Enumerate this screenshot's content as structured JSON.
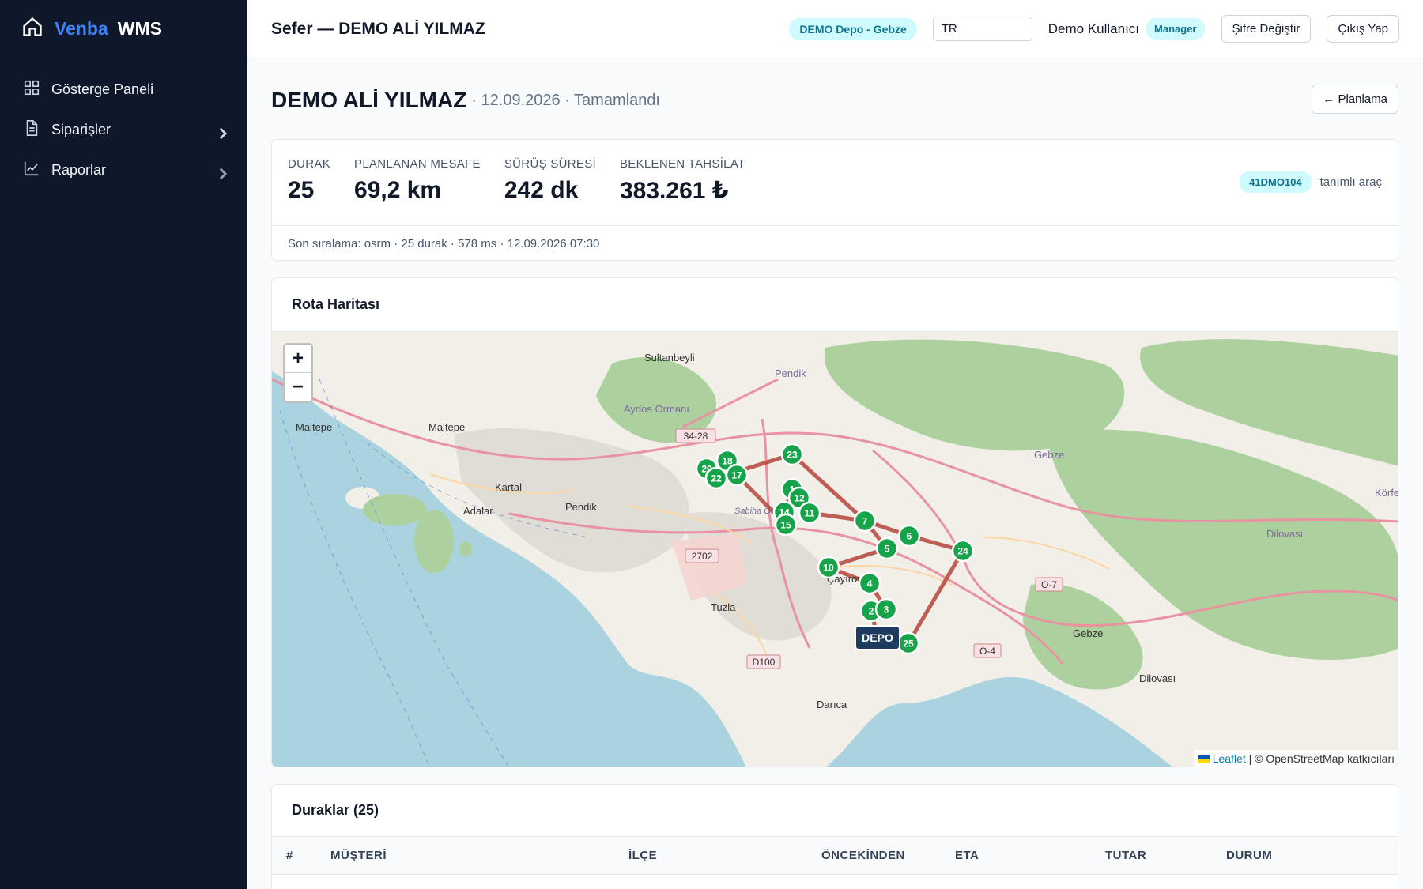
{
  "sidebar": {
    "brand_part1": "Venba",
    "brand_part2": "WMS",
    "items": [
      {
        "label": "Gösterge Paneli",
        "icon": "grid-icon"
      },
      {
        "label": "Siparişler",
        "icon": "document-icon"
      },
      {
        "label": "Raporlar",
        "icon": "chart-line-icon"
      }
    ]
  },
  "header": {
    "title": "Sefer — DEMO ALİ YILMAZ",
    "depot": "DEMO Depo - Gebze",
    "language_value": "TR",
    "user_name": "Demo Kullanıcı",
    "role": "Manager",
    "change_password": "Şifre Değiştir",
    "logout": "Çıkış Yap"
  },
  "page": {
    "driver": "DEMO ALİ YILMAZ",
    "meta": "· 12.09.2026 · Tamamlandı",
    "back_label": "← Planlama"
  },
  "stats": {
    "items": [
      {
        "label": "DURAK",
        "value": "25"
      },
      {
        "label": "PLANLANAN MESAFE",
        "value": "69,2 km"
      },
      {
        "label": "SÜRÜŞ SÜRESİ",
        "value": "242 dk"
      },
      {
        "label": "BEKLENEN TAHSİLAT",
        "value": "383.261 ₺"
      }
    ],
    "plate": "41DMO104",
    "plate_note": "tanımlı araç",
    "last_sort": "Son sıralama: osrm · 25 durak · 578 ms · 12.09.2026 07:30"
  },
  "map": {
    "title": "Rota Haritası",
    "zoom_in": "+",
    "zoom_out": "−",
    "attribution_leaflet": "Leaflet",
    "attribution_rest": "| © OpenStreetMap katkıcıları",
    "depot_label": "DEPO",
    "place_labels": [
      "Sultanbeyli",
      "Pendik",
      "Maltepe",
      "Aydos Ormanı",
      "Maltepe",
      "Kartal",
      "Pendik",
      "Adalar",
      "Sabiha Gökçen Havalimanı (SAW)",
      "Gebze",
      "Çayırova",
      "Tuzla",
      "Gebze",
      "Dilovası",
      "Darıca",
      "Dilovası",
      "Körfez"
    ],
    "road_labels": [
      "34-28",
      "2702",
      "D100",
      "O-7",
      "O-4"
    ],
    "stop_numbers": [
      "23",
      "18",
      "20",
      "22",
      "17",
      "1",
      "12",
      "14",
      "11",
      "15",
      "7",
      "6",
      "5",
      "24",
      "10",
      "4",
      "2",
      "3",
      "25"
    ],
    "colors": {
      "water": "#aad3df",
      "land": "#f2efe9",
      "forest": "#add19e",
      "route": "#b5443a",
      "pin": "#16a34a",
      "depot": "#1e3a5f"
    }
  },
  "stops": {
    "title": "Duraklar (25)",
    "columns": [
      "#",
      "MÜŞTERİ",
      "İLÇE",
      "ÖNCEKİNDEN",
      "ETA",
      "TUTAR",
      "DURUM"
    ]
  }
}
